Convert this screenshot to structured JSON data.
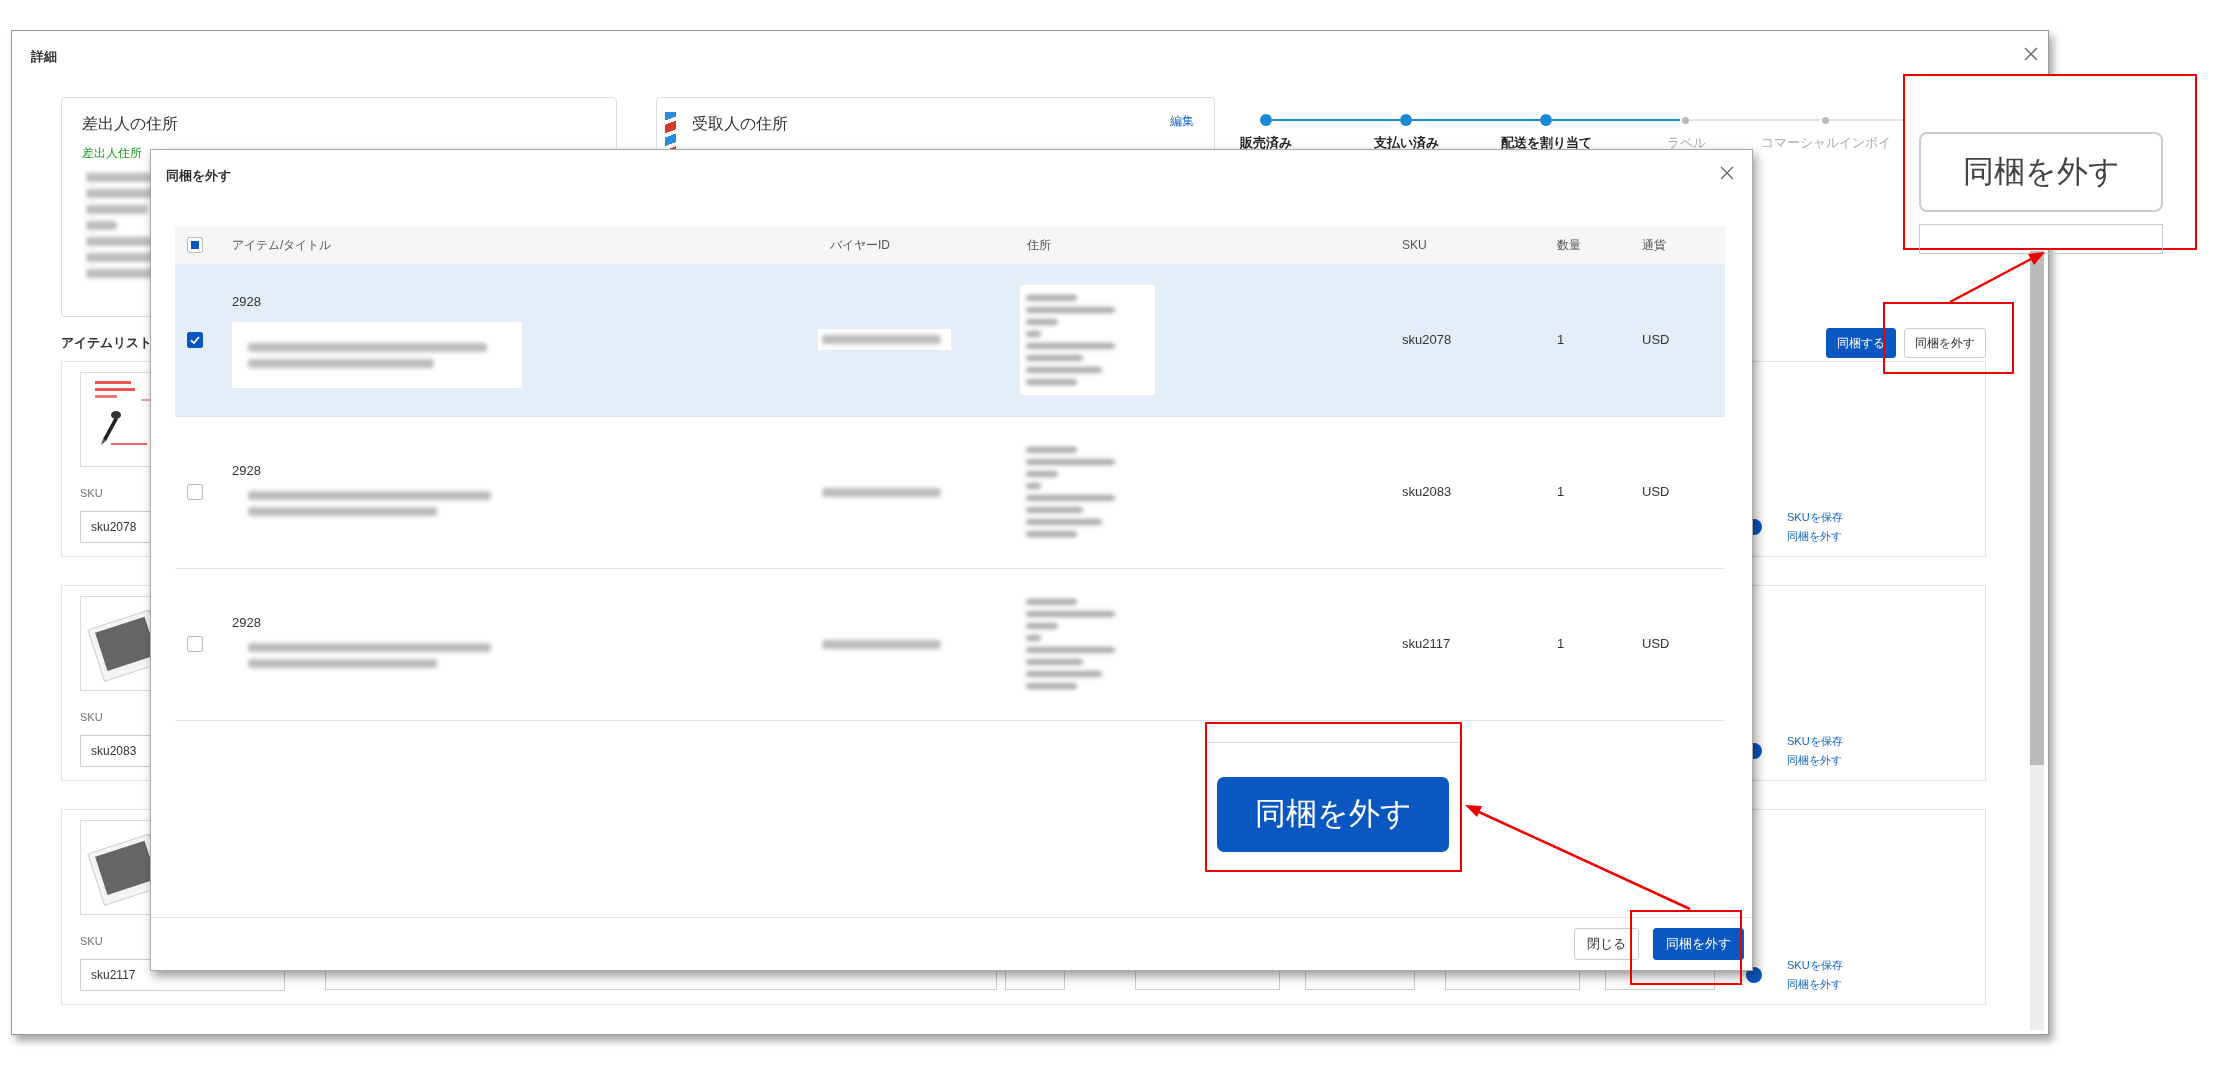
{
  "dialog": {
    "title": "詳細"
  },
  "sender": {
    "title": "差出人の住所",
    "note": "差出人住所",
    "redacted": true
  },
  "recipient": {
    "title": "受取人の住所",
    "edit": "編集"
  },
  "steps": [
    {
      "label": "販売済み",
      "done": true
    },
    {
      "label": "支払い済み",
      "done": true
    },
    {
      "label": "配送を割り当て",
      "done": true
    },
    {
      "label": "ラベル",
      "done": false
    },
    {
      "label": "コマーシャルインボイ",
      "done": false
    }
  ],
  "item_list": {
    "title": "アイテムリスト",
    "buttons": [
      {
        "label": "同梱する",
        "kind": "primary",
        "highlighted": false
      },
      {
        "label": "同梱を外す",
        "kind": "outline",
        "highlighted": true
      }
    ]
  },
  "items": [
    {
      "kind": "picture",
      "sku_label": "SKU",
      "sku": "sku2078",
      "links": [
        "SKUを保存",
        "同梱を外す"
      ]
    },
    {
      "kind": "placeholder",
      "sku_label": "SKU",
      "sku": "sku2083",
      "links": [
        "SKUを保存",
        "同梱を外す"
      ]
    },
    {
      "kind": "placeholder",
      "sku_label": "SKU",
      "sku": "sku2117",
      "links": [
        "SKUを保存",
        "同梱を外す"
      ]
    }
  ],
  "modal": {
    "title": "同梱を外す",
    "select_all": {
      "checked": false,
      "indeterminate": true
    },
    "columns": [
      "アイテム/タイトル",
      "バイヤーID",
      "住所",
      "SKU",
      "数量",
      "通貨"
    ],
    "rows": [
      {
        "id": "2928",
        "selected": true,
        "checked": true,
        "redacted": true,
        "sku": "sku2078",
        "quantity": "1",
        "currency": "USD"
      },
      {
        "id": "2928",
        "selected": false,
        "checked": false,
        "redacted": true,
        "sku": "sku2083",
        "quantity": "1",
        "currency": "USD"
      },
      {
        "id": "2928",
        "selected": false,
        "checked": false,
        "redacted": true,
        "sku": "sku2117",
        "quantity": "1",
        "currency": "USD"
      }
    ],
    "buttons": [
      {
        "label": "閉じる",
        "kind": "secondary",
        "highlighted": false
      },
      {
        "label": "同梱を外す",
        "kind": "primary",
        "highlighted": true
      }
    ]
  },
  "callouts": [
    {
      "label": "同梱を外す",
      "kind": "outline"
    },
    {
      "label": "同梱を外す",
      "kind": "primary"
    }
  ]
}
